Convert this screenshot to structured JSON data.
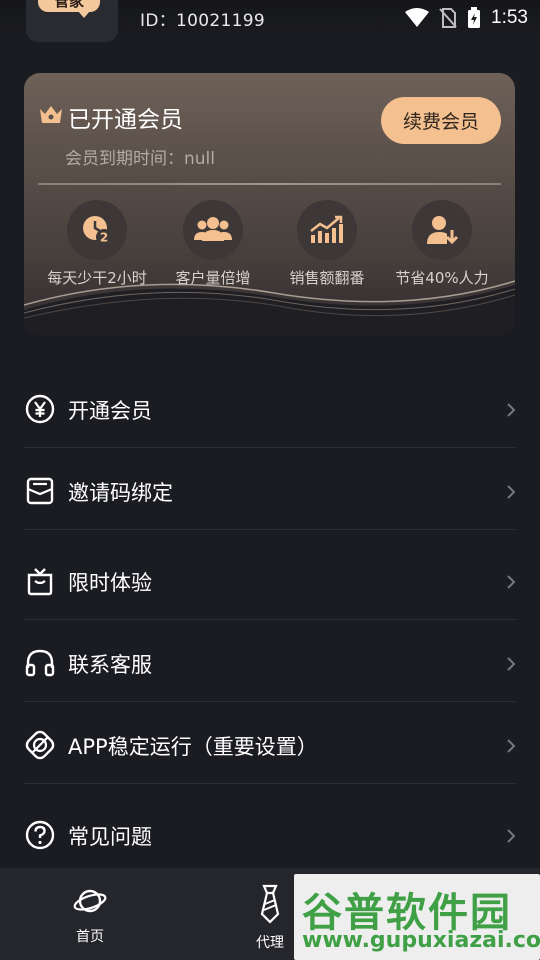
{
  "header": {
    "logo_text": "管家",
    "uid": "ID：10021199"
  },
  "status_bar": {
    "time": "1:53"
  },
  "member_card": {
    "title": "已开通会员",
    "expiry": "会员到期时间：null",
    "renew_label": "续费会员",
    "benefits": [
      {
        "label": "每天少干2小时",
        "icon": "clock-icon"
      },
      {
        "label": "客户量倍增",
        "icon": "users-icon"
      },
      {
        "label": "销售额翻番",
        "icon": "growth-chart-icon"
      },
      {
        "label": "节省40%人力",
        "icon": "person-down-icon"
      }
    ]
  },
  "menu": {
    "items": [
      {
        "label": "开通会员",
        "icon": "yen-icon"
      },
      {
        "label": "邀请码绑定",
        "icon": "envelope-icon"
      },
      {
        "label": "限时体验",
        "icon": "gift-box-icon"
      },
      {
        "label": "联系客服",
        "icon": "headphones-icon"
      },
      {
        "label": "APP稳定运行（重要设置）",
        "icon": "shield-icon"
      },
      {
        "label": "常见问题",
        "icon": "question-icon"
      }
    ]
  },
  "bottom_nav": {
    "items": [
      {
        "label": "首页",
        "icon": "planet-icon"
      },
      {
        "label": "代理",
        "icon": "tie-icon"
      }
    ]
  },
  "watermark": {
    "line1": "谷普软件园",
    "line2": "www.gupuxiazai.com"
  },
  "colors": {
    "background": "#1b1c21",
    "accent": "#f4c08f",
    "card": "#5a4f49"
  }
}
